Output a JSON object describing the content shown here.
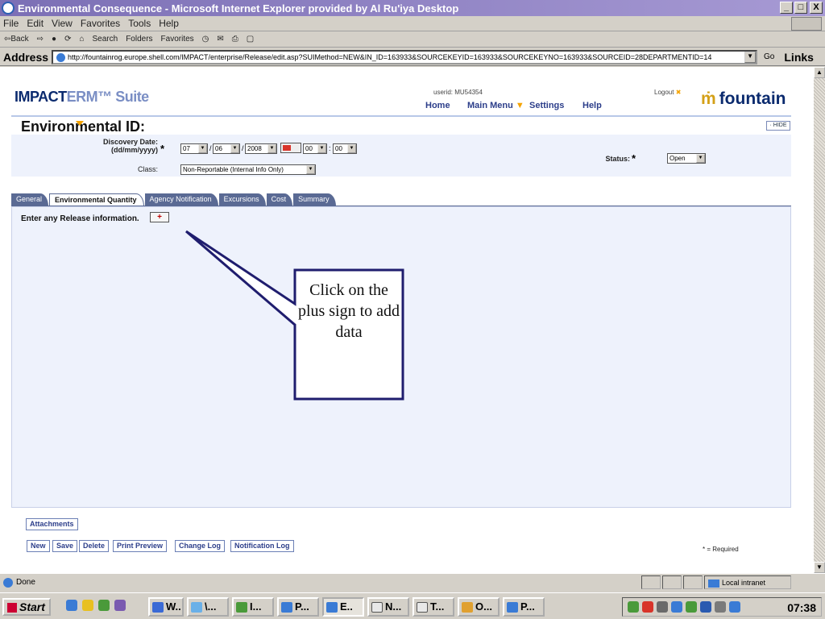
{
  "window": {
    "title": "Environmental Consequence - Microsoft Internet Explorer provided by Al Ru'iya Desktop",
    "buttons": [
      "_",
      "□",
      "X"
    ]
  },
  "menu": [
    "File",
    "Edit",
    "View",
    "Favorites",
    "Tools",
    "Help"
  ],
  "toolbar": {
    "back": "⇦Back",
    "forward": "⇨",
    "search": "Search",
    "folders": "Folders",
    "favorites": "Favorites"
  },
  "address": {
    "label": "Address",
    "url": "http://fountainrog.europe.shell.com/IMPACT/enterprise/Release/edit.asp?SUIMethod=NEW&IN_ID=163933&SOURCEKEYID=163933&SOURCEKEYNO=163933&SOURCEID=28DEPARTMENTID=14",
    "go": "Go",
    "links": "Links"
  },
  "app": {
    "logo_main": "IMPACT",
    "logo_erm": "ERM™",
    "logo_suite": "Suite",
    "userid": "userid: MU54354",
    "logout": "Logout",
    "nav": [
      "Home",
      "Main Menu",
      "Settings",
      "Help"
    ],
    "brand": "fountain"
  },
  "form": {
    "title": "Environmental ID:",
    "hide": "· HIDE",
    "discovery_label": "Discovery Date:",
    "discovery_format": "(dd/mm/yyyy)",
    "day": "07",
    "month": "06",
    "year": "2008",
    "hour": "00",
    "minute": "00",
    "class_label": "Class:",
    "class_value": "Non-Reportable (Internal Info Only)",
    "status_label": "Status:",
    "status_value": "Open",
    "required_star": "*"
  },
  "tabs": [
    "General",
    "Environmental Quantity",
    "Agency Notification",
    "Excursions",
    "Cost",
    "Summary"
  ],
  "release_text": "Enter any Release information.",
  "plus": "+",
  "callout": "Click on the plus sign to add data",
  "buttons": {
    "attachments": "Attachments",
    "new": "New",
    "save": "Save",
    "delete": "Delete",
    "print_preview": "Print Preview",
    "change_log": "Change Log",
    "notification_log": "Notification Log"
  },
  "required_note": "* = Required",
  "status": {
    "text": "Done",
    "zone": "Local intranet"
  },
  "taskbar": {
    "start": "Start",
    "tasks": [
      "W..",
      "\\...",
      "I...",
      "P...",
      "E..",
      "N...",
      "T...",
      "O...",
      "P..."
    ],
    "clock": "07:38"
  }
}
